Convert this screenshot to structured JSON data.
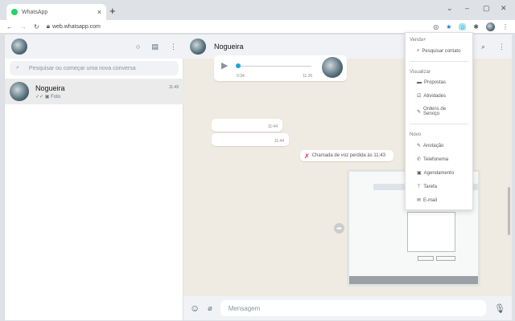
{
  "browser": {
    "tab_title": "WhatsApp",
    "url": "web.whatsapp.com"
  },
  "left": {
    "search_placeholder": "Pesquisar ou começar uma nova conversa",
    "chats": [
      {
        "name": "Nogueira",
        "time": "11:49",
        "preview": "Foto"
      }
    ]
  },
  "chat": {
    "contact": "Nogueira",
    "voice": {
      "elapsed": "0:34",
      "time": "11:26",
      "progress": 0.02
    },
    "messages": [
      {
        "time": "11:44"
      },
      {
        "time": "11:44"
      }
    ],
    "missed_call": "Chamada de voz perdida às 11:43",
    "composer_placeholder": "Mensagem"
  },
  "menu": {
    "sections": [
      {
        "title": "Venda+",
        "items": [
          {
            "icon": "search-icon",
            "label": "Pesquisar contato",
            "glyph": "⌕"
          }
        ]
      },
      {
        "title": "Visualizar",
        "items": [
          {
            "icon": "folder-icon",
            "label": "Propostas",
            "glyph": "▬"
          },
          {
            "icon": "check-icon",
            "label": "Atividades",
            "glyph": "☑"
          },
          {
            "icon": "wrench-icon",
            "label": "Ordens de Serviço",
            "glyph": "✎"
          }
        ]
      },
      {
        "title": "Novo",
        "items": [
          {
            "icon": "pencil-icon",
            "label": "Anotação",
            "glyph": "✎"
          },
          {
            "icon": "phone-icon",
            "label": "Telefonema",
            "glyph": "✆"
          },
          {
            "icon": "calendar-icon",
            "label": "Agendamento",
            "glyph": "▣"
          },
          {
            "icon": "pin-icon",
            "label": "Tarefa",
            "glyph": "⊤"
          },
          {
            "icon": "mail-icon",
            "label": "E-mail",
            "glyph": "✉"
          }
        ]
      }
    ]
  },
  "colors": {
    "accent": "#25d366",
    "missed": "#e0245e",
    "progress": "#1fa5d8"
  }
}
